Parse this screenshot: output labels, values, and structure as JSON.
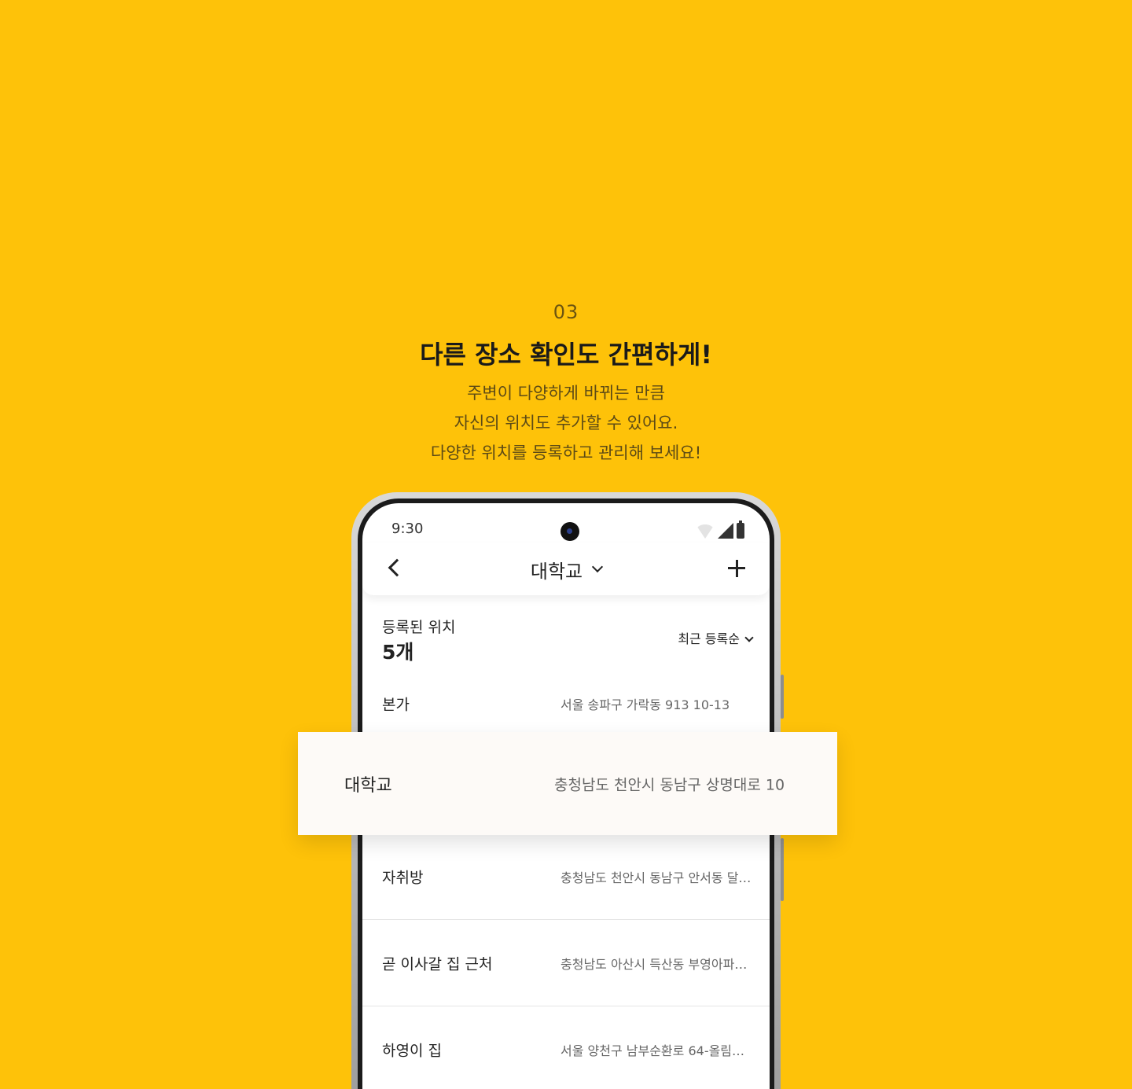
{
  "promo": {
    "step_number": "03",
    "headline": "다른 장소 확인도 간편하게!",
    "description_lines": [
      "주변이 다양하게 바뀌는 만큼",
      "자신의 위치도 추가할 수 있어요.",
      "다양한 위치를 등록하고 관리해 보세요!"
    ]
  },
  "status_bar": {
    "time": "9:30"
  },
  "header": {
    "back_icon": "chevron-left-icon",
    "title": "대학교",
    "title_dropdown_icon": "chevron-down-icon",
    "add_icon": "plus-icon"
  },
  "summary": {
    "label": "등록된 위치",
    "count": "5개",
    "sort_label": "최근 등록순"
  },
  "locations": [
    {
      "name": "본가",
      "address": "서울 송파구 가락동 913 10-13"
    },
    {
      "name": "대학교",
      "address": "충청남도 천안시 동남구 상명대로 10",
      "highlighted": true
    },
    {
      "name": "자취방",
      "address": "충청남도 천안시 동남구 안서동 달…"
    },
    {
      "name": "곧 이사갈 집 근처",
      "address": "충청남도 아산시 득산동 부영아파…"
    },
    {
      "name": "하영이 집",
      "address": "서울 양천구 남부순환로 64-올림…"
    }
  ],
  "colors": {
    "background": "#FEC209",
    "highlight_card": "#FDFAF7"
  }
}
